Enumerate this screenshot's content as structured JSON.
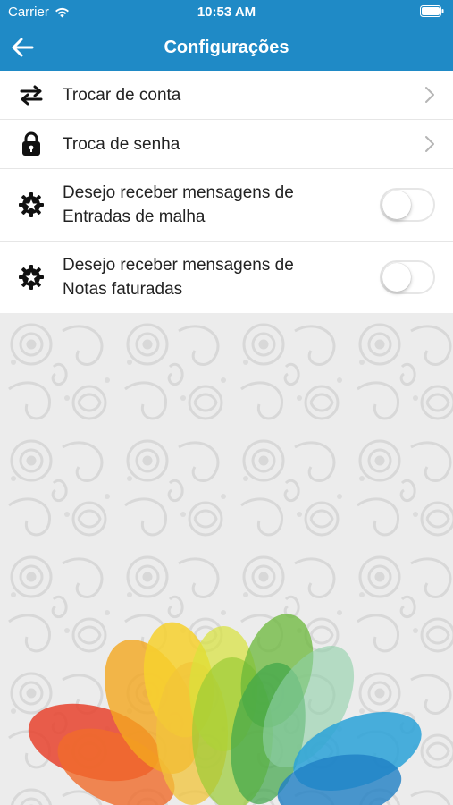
{
  "status_bar": {
    "carrier": "Carrier",
    "time": "10:53 AM"
  },
  "nav": {
    "title": "Configurações",
    "back_icon": "arrow-left-icon"
  },
  "settings": {
    "items": [
      {
        "icon": "swap-arrows-icon",
        "label": "Trocar de conta",
        "control": "chevron"
      },
      {
        "icon": "lock-icon",
        "label": "Troca de senha",
        "control": "chevron"
      },
      {
        "icon": "gear-icon",
        "label_line1": "Desejo receber mensagens de",
        "label_line2": "Entradas de malha",
        "control": "toggle",
        "enabled": false
      },
      {
        "icon": "gear-icon",
        "label_line1": "Desejo receber mensagens de",
        "label_line2": "Notas faturadas",
        "control": "toggle",
        "enabled": false
      }
    ]
  },
  "colors": {
    "accent": "#1f8ac6",
    "background_pattern": "#e9e9e9"
  }
}
